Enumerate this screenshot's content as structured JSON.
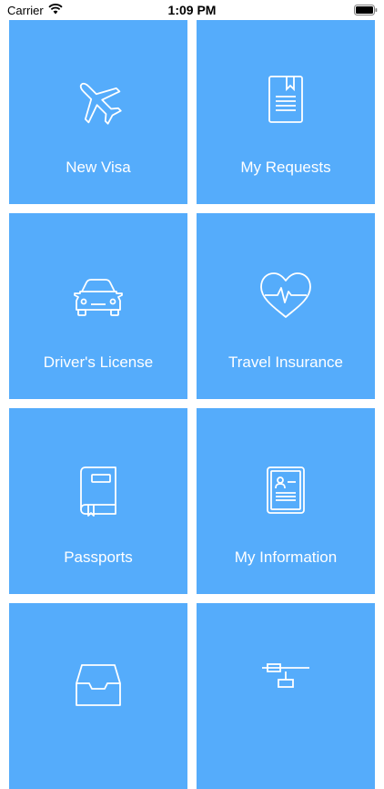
{
  "status_bar": {
    "carrier": "Carrier",
    "time": "1:09 PM"
  },
  "colors": {
    "tile_background": "#55acfb",
    "icon_stroke": "#ffffff",
    "label_text": "#ffffff"
  },
  "tiles": [
    {
      "label": "New Visa",
      "icon": "airplane-icon"
    },
    {
      "label": "My Requests",
      "icon": "document-bookmark-icon"
    },
    {
      "label": "Driver's License",
      "icon": "car-icon"
    },
    {
      "label": "Travel Insurance",
      "icon": "heart-pulse-icon"
    },
    {
      "label": "Passports",
      "icon": "passport-book-icon"
    },
    {
      "label": "My Information",
      "icon": "profile-document-icon"
    },
    {
      "label": "",
      "icon": "inbox-tray-icon"
    },
    {
      "label": "",
      "icon": "timeline-icon"
    }
  ]
}
